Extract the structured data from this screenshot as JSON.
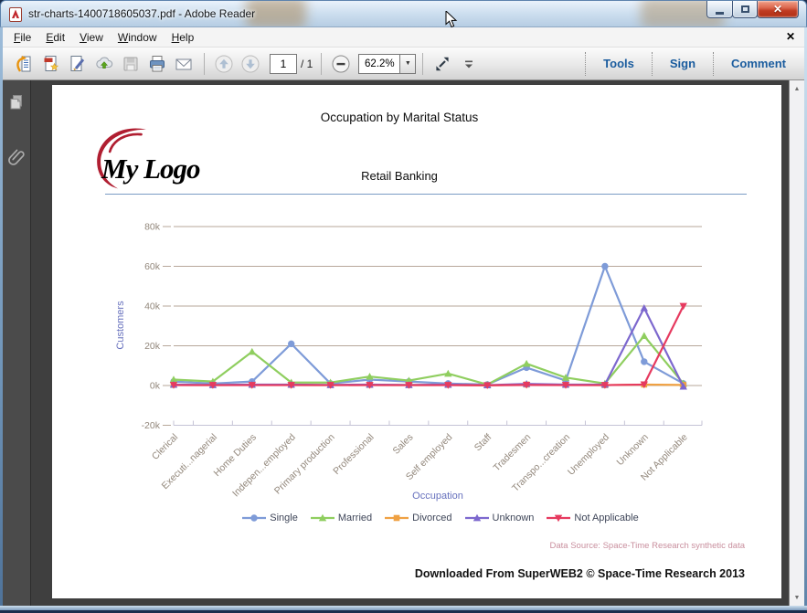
{
  "window": {
    "title": "str-charts-1400718605037.pdf - Adobe Reader"
  },
  "menu": {
    "items": [
      "File",
      "Edit",
      "View",
      "Window",
      "Help"
    ]
  },
  "toolbar": {
    "page_current": "1",
    "page_total": "/ 1",
    "zoom_value": "62.2%",
    "right_buttons": [
      "Tools",
      "Sign",
      "Comment"
    ],
    "icons": [
      "open",
      "create-pdf",
      "fill-and-sign",
      "send-to-cloud",
      "save",
      "print",
      "email",
      "previous-page",
      "next-page",
      "zoom-out",
      "fit-window",
      "more-tools"
    ]
  },
  "document": {
    "page_title": "Occupation by Marital Status",
    "logo_text": "My Logo",
    "subtitle": "Retail Banking",
    "data_source": "Data Source: Space-Time Research synthetic data",
    "footer": "Downloaded From SuperWEB2 © Space-Time Research 2013"
  },
  "chart_data": {
    "type": "line",
    "title": "Occupation by Marital Status",
    "subtitle": "Retail Banking",
    "xlabel": "Occupation",
    "ylabel": "Customers",
    "ylim": [
      -20000,
      90000
    ],
    "yticks": [
      -20000,
      0,
      20000,
      40000,
      60000,
      80000
    ],
    "ytick_labels": [
      "-20k",
      "0k",
      "20k",
      "40k",
      "60k",
      "80k"
    ],
    "grid": true,
    "legend_position": "bottom",
    "categories": [
      "Clerical",
      "Executi...nagerial",
      "Home Duties",
      "Indepen...employed",
      "Primary production",
      "Professional",
      "Sales",
      "Self employed",
      "Staff",
      "Tradesmen",
      "Transpo...creation",
      "Unemployed",
      "Unknown",
      "Not Applicable"
    ],
    "series": [
      {
        "name": "Single",
        "color": "#7e9bd8",
        "marker": "circle",
        "values": [
          2000,
          1000,
          2000,
          21000,
          1000,
          3000,
          2000,
          1000,
          500,
          9000,
          2500,
          60000,
          12000,
          1000
        ]
      },
      {
        "name": "Married",
        "color": "#8fce5f",
        "marker": "triangle-up",
        "values": [
          3000,
          2000,
          17000,
          1500,
          1500,
          4500,
          2500,
          6000,
          500,
          11000,
          4000,
          1000,
          25000,
          1000
        ]
      },
      {
        "name": "Divorced",
        "color": "#efa143",
        "marker": "square",
        "values": [
          300,
          200,
          300,
          300,
          200,
          300,
          200,
          300,
          100,
          500,
          300,
          200,
          500,
          300
        ]
      },
      {
        "name": "Unknown",
        "color": "#7d68ce",
        "marker": "triangle-up",
        "values": [
          500,
          300,
          500,
          500,
          300,
          500,
          300,
          500,
          200,
          800,
          500,
          500,
          39000,
          -500
        ]
      },
      {
        "name": "Not Applicable",
        "color": "#e63a5f",
        "marker": "triangle-down",
        "values": [
          200,
          200,
          200,
          200,
          200,
          200,
          200,
          200,
          100,
          300,
          200,
          200,
          500,
          40000
        ]
      }
    ]
  }
}
